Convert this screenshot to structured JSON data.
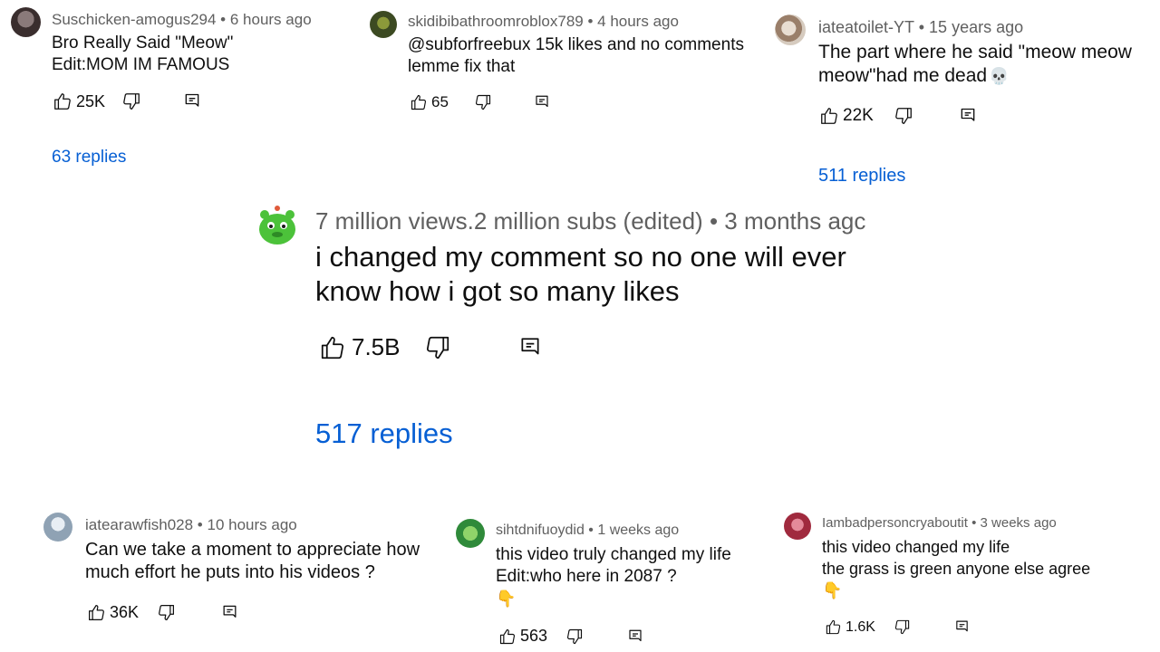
{
  "comments": [
    {
      "user": "Suschicken-amogus294",
      "sep": " • ",
      "time": "6 hours ago",
      "lines": [
        "Bro Really Said \"Meow\"",
        "Edit:MOM IM FAMOUS"
      ],
      "likes": "25K",
      "replies": "63 replies",
      "avatar_color": "#5a4a4a"
    },
    {
      "user": "skidibibathroomroblox789",
      "sep": " • ",
      "time": "4 hours ago",
      "lines": [
        "@subforfreebux 15k likes and no comments",
        "lemme fix that"
      ],
      "likes": "65",
      "avatar_color": "#4a5a2a"
    },
    {
      "user": "iateatoilet-YT",
      "sep": " • ",
      "time": "15 years ago",
      "lines": [
        "The part where he said \"meow meow",
        "meow\"had me dead"
      ],
      "emoji": "💀",
      "likes": "22K",
      "replies": "511 replies",
      "avatar_color": "#c9b8a8"
    },
    {
      "user": "7 million views.2 million subs (edited)",
      "sep": " • ",
      "time": "3 months agc",
      "lines": [
        "i changed my comment so no one will ever",
        "know how i got so many likes"
      ],
      "likes": "7.5B",
      "replies": "517 replies",
      "avatar_color": "#4cc23a"
    },
    {
      "user": "iatearawfish028",
      "sep": " • ",
      "time": "10 hours ago",
      "lines": [
        "Can we take a moment to appreciate how",
        "much effort he puts into his videos ?"
      ],
      "likes": "36K",
      "avatar_color": "#a9b7c4"
    },
    {
      "user": "sihtdnifuoydid",
      "sep": " • ",
      "time": "1 weeks ago",
      "lines": [
        "this video truly changed my life",
        "Edit:who here in 2087 ?"
      ],
      "emoji": "👇",
      "likes": "563",
      "avatar_color": "#3aa84a"
    },
    {
      "user": "Iambadpersoncryaboutit",
      "sep": " • ",
      "time": "3 weeks ago",
      "lines": [
        "this video changed my life",
        "the grass is green anyone else agree"
      ],
      "emoji": "👇",
      "likes": "1.6K",
      "avatar_color": "#b03a4a"
    }
  ],
  "colors": {
    "link": "#065fd4",
    "meta": "#606060",
    "text": "#0f0f0f"
  },
  "icons": [
    "thumb-up-icon",
    "thumb-down-icon",
    "reply-icon"
  ]
}
